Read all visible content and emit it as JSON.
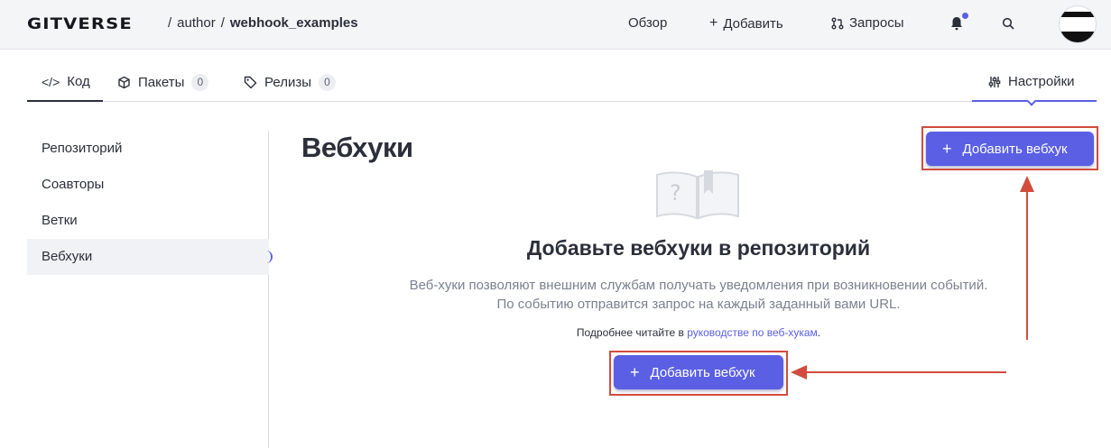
{
  "header": {
    "logo": "GITVERSE",
    "breadcrumb": {
      "sep1": "/",
      "owner": "author",
      "sep2": "/",
      "repo": "webhook_examples"
    },
    "nav": {
      "overview": "Обзор",
      "add": "Добавить",
      "requests": "Запросы"
    }
  },
  "tabs": {
    "code": "Код",
    "packages": "Пакеты",
    "packages_count": "0",
    "releases": "Релизы",
    "releases_count": "0",
    "settings": "Настройки"
  },
  "sidebar": {
    "items": [
      {
        "label": "Репозиторий"
      },
      {
        "label": "Соавторы"
      },
      {
        "label": "Ветки"
      },
      {
        "label": "Вебхуки"
      }
    ],
    "active_index": 3
  },
  "main": {
    "title": "Вебхуки",
    "add_button": "Добавить вебхук",
    "empty_title": "Добавьте вебхуки в репозиторий",
    "empty_desc_line1": "Веб-хуки позволяют внешним службам получать уведомления при возникновении событий.",
    "empty_desc_line2": "По событию отправится запрос на каждый заданный вами URL.",
    "more_prefix": "Подробнее читайте в ",
    "more_link": "руководстве по веб-хукам",
    "more_suffix": ".",
    "empty_button": "Добавить вебхук"
  },
  "colors": {
    "accent": "#5a5fe4",
    "highlight": "#d24c3e"
  },
  "icons": [
    "code-icon",
    "package-icon",
    "tag-icon",
    "sliders-icon",
    "plus-icon",
    "pull-request-icon",
    "bell-icon",
    "search-icon",
    "book-icon"
  ]
}
